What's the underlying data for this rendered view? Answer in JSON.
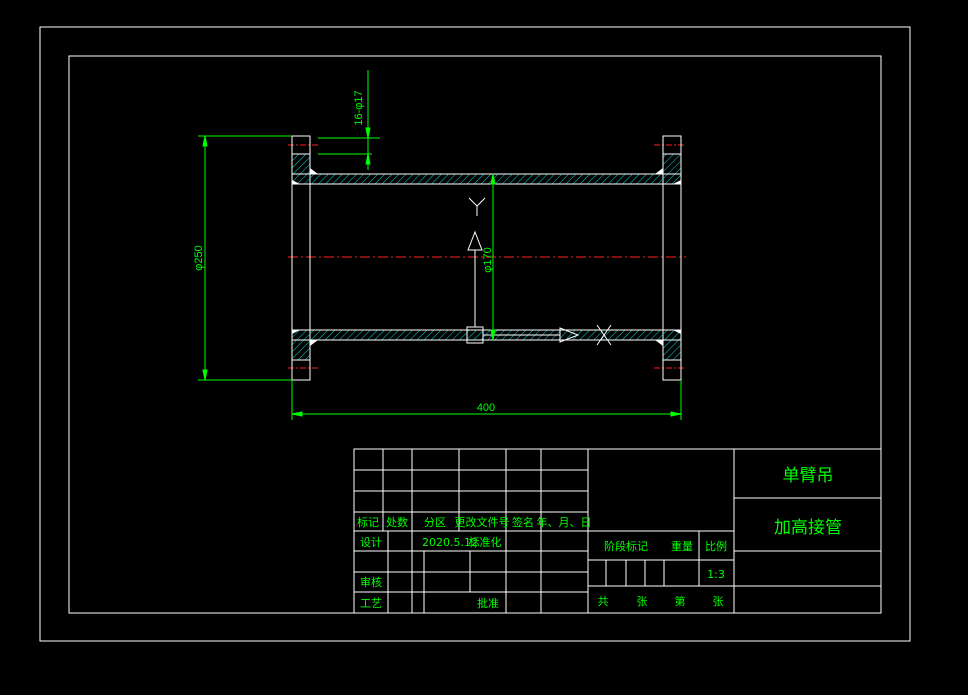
{
  "dimensions": {
    "bolt_holes": "16-φ17",
    "outer_diameter": "φ250",
    "inner_diameter": "φ170",
    "length": "400"
  },
  "title_block": {
    "product_name": "单臂吊",
    "part_name": "加高接管",
    "headers": {
      "mark": "标记",
      "count": "处数",
      "zone": "分区",
      "doc_no": "更改文件号",
      "signature": "签名",
      "date": "年、月、日"
    },
    "rows": {
      "design": "设计",
      "design_date": "2020.5.12",
      "standardization": "标准化",
      "review": "审核",
      "process": "工艺",
      "approve": "批准"
    },
    "stage_mark": "阶段标记",
    "weight": "重量",
    "scale_label": "比例",
    "scale_value": "1:3",
    "total": "共",
    "sheets_a": "张",
    "sheet_no": "第",
    "sheets_b": "张"
  },
  "colors": {
    "line": "#ffffff",
    "hatch": "#00e5e5",
    "dimension": "#00ff00",
    "centerline": "#ff2020",
    "text": "#00ff00"
  }
}
